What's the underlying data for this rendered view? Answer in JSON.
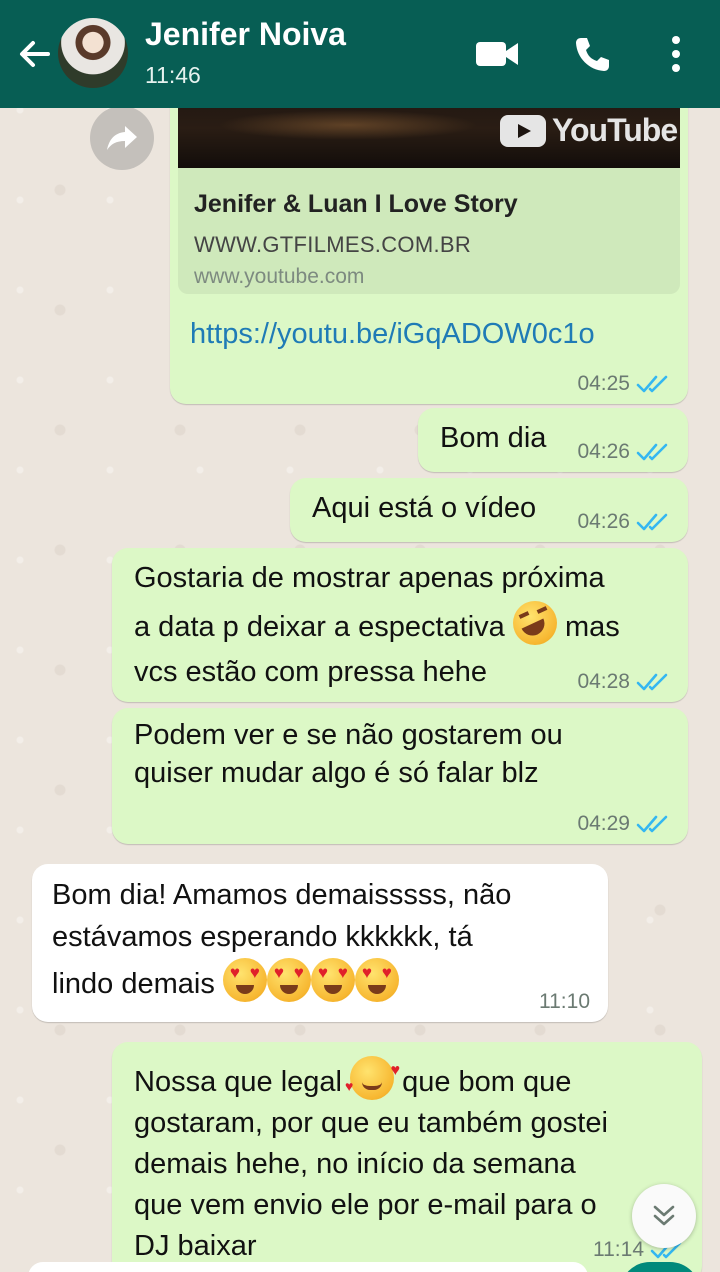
{
  "header": {
    "contact_name": "Jenifer Noiva",
    "last_seen": "11:46",
    "accent": "#075e54"
  },
  "link_message": {
    "preview_brand": "YouTube",
    "preview_title": "Jenifer & Luan I Love Story",
    "preview_desc": "WWW.GTFILMES.COM.BR",
    "preview_site": "www.youtube.com",
    "url": "https://youtu.be/iGqADOW0c1o",
    "time": "04:25"
  },
  "messages": [
    {
      "text": "Bom dia",
      "time": "04:26"
    },
    {
      "text": "Aqui está o vídeo",
      "time": "04:26"
    },
    {
      "line1": "Gostaria de mostrar apenas próxima",
      "line2a": "a data p deixar a espectativa",
      "line2b": "mas",
      "line3": "vcs estão com pressa hehe",
      "time": "04:28"
    },
    {
      "line1": "Podem ver e se não gostarem ou",
      "line2": "quiser mudar algo é só falar blz",
      "time": "04:29"
    },
    {
      "line1": "Bom dia! Amamos demaisssss, não",
      "line2": "estávamos esperando kkkkkk, tá",
      "line3": "lindo demais",
      "time": "11:10"
    },
    {
      "line1a": "Nossa que legal",
      "line1b": "que bom que",
      "line2": "gostaram, por que eu também gostei",
      "line3": "demais hehe, no início da semana",
      "line4": "que vem envio ele por e-mail para o",
      "line5": "DJ baixar",
      "time": "11:14"
    }
  ],
  "icons": [
    "back-arrow-icon",
    "video-call-icon",
    "phone-icon",
    "more-options-icon",
    "forward-icon",
    "double-check-icon",
    "chevron-down-icon"
  ],
  "colors": {
    "outgoing_bubble": "#dcf8c6",
    "incoming_bubble": "#ffffff",
    "read_ticks": "#34b7f1",
    "link": "#1f7bb6"
  }
}
